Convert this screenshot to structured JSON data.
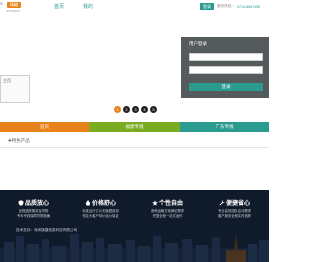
{
  "header": {
    "logo_badge": "精编",
    "logo_sub": "JINGBIAN",
    "logo_mark": "≤",
    "nav": [
      "首页",
      "我的"
    ],
    "login_button": "登录",
    "service_text": "服务热线：",
    "phone": "0713-8687456"
  },
  "banner": {
    "image_alt": "主页",
    "dots": [
      "1",
      "2",
      "3",
      "4",
      "5"
    ],
    "active_dot": 0
  },
  "login": {
    "title": "用户登录",
    "submit": "登录"
  },
  "tabs": [
    "首页",
    "福建专线",
    "广东专线"
  ],
  "products": {
    "link": "✚特色产品"
  },
  "footer": {
    "features": [
      {
        "title": "品质放心",
        "lines": [
          "全程追踪服务及货物",
          "专车专线保障货物准确"
        ]
      },
      {
        "title": "价格舒心",
        "lines": [
          "标准运行订价无隐藏费用",
          "恒定大客户特价运价保证"
        ]
      },
      {
        "title": "个性自由",
        "lines": [
          "各种运输方案满足需求",
          "完整全程一站式运作"
        ]
      },
      {
        "title": "便捷省心",
        "lines": [
          "专业高效团队应对需求",
          "客户服务全程实时追踪"
        ]
      }
    ],
    "copyright": "技术支持：深圳旗捷信息科技有限公司"
  },
  "colors": {
    "teal": "#2b9b90",
    "orange": "#e8831c",
    "green": "#7aac22",
    "login_bg": "#555b5d",
    "footer_bg": "#0f1a2a"
  }
}
